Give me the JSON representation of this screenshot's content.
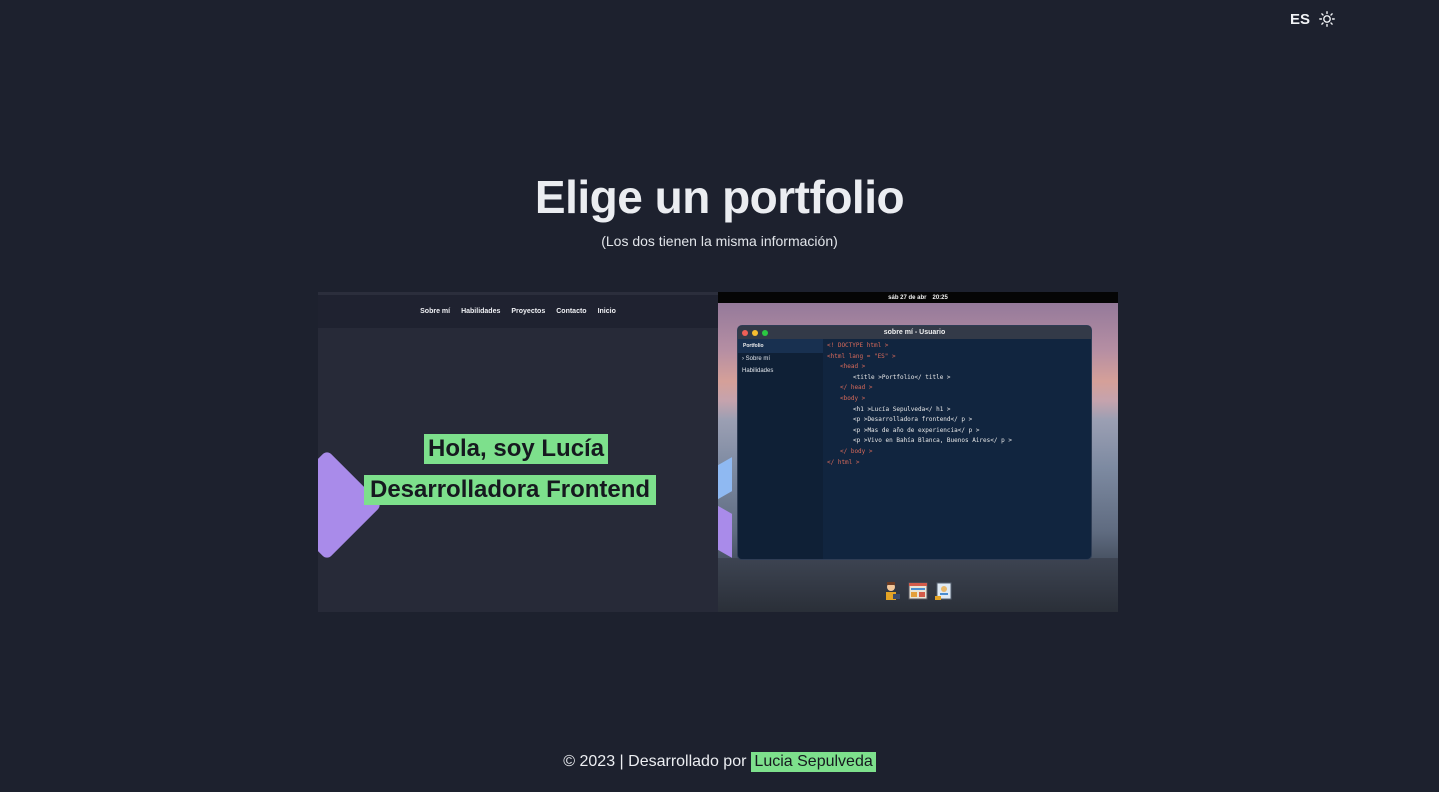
{
  "header": {
    "language_label": "ES",
    "theme_icon": "sun-icon"
  },
  "main": {
    "title": "Elige un portfolio",
    "subtitle": "(Los dos tienen la misma información)"
  },
  "cards": {
    "left": {
      "nav_items": [
        "Sobre mí",
        "Habilidades",
        "Proyectos",
        "Contacto",
        "Inicio"
      ],
      "hero_line1": "Hola, soy Lucía",
      "hero_line2": "Desarrolladora Frontend",
      "accent_color": "#7de08c"
    },
    "right": {
      "menubar_date": "sáb 27 de abr",
      "menubar_time": "20:25",
      "window_title": "sobre mí - Usuario",
      "sidebar_header": "Portfolio",
      "sidebar_items": [
        "Sobre mí",
        "Habilidades"
      ],
      "code_lines": [
        "<! DOCTYPE html >",
        "<html lang = \"ES\" >",
        "<head >",
        "<title >Portfolio</ title >",
        "</ head >",
        "<body >",
        "<h1 >Lucía Sepulveda</ h1 >",
        "<p >Desarrolladora frontend</ p >",
        "<p >Mas de año de experiencia</ p >",
        "<p >Vivo en Bahía Blanca, Buenos Aires</ p >",
        "</ body >",
        "</ html >"
      ],
      "dock_icons": [
        "developer-avatar-icon",
        "browser-window-icon",
        "contact-card-icon"
      ]
    }
  },
  "footer": {
    "text": "© 2023 | Desarrollado por",
    "author": "Lucia Sepulveda"
  }
}
